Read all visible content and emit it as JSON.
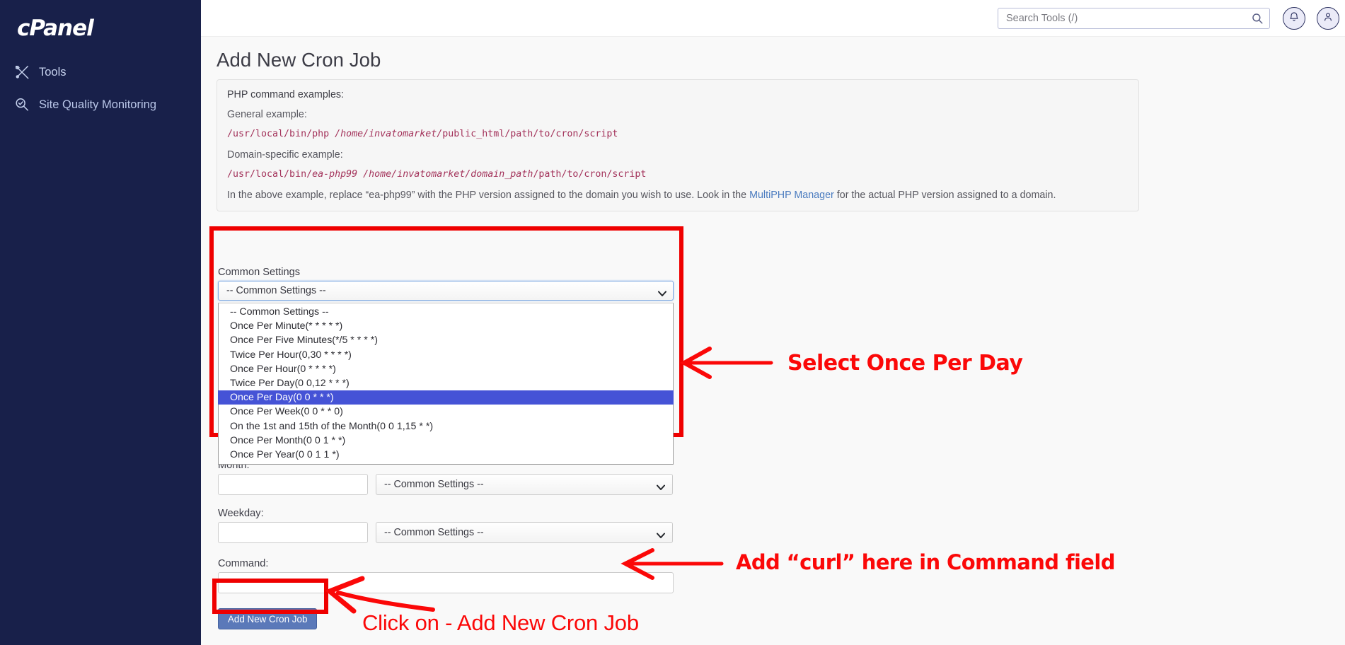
{
  "sidebar": {
    "brand": "cPanel",
    "items": [
      {
        "label": "Tools",
        "icon": "tools-icon"
      },
      {
        "label": "Site Quality Monitoring",
        "icon": "site-quality-icon"
      }
    ]
  },
  "header": {
    "search_placeholder": "Search Tools (/)",
    "search_value": "",
    "search_icon": "search-icon",
    "notifications_icon": "bell-icon",
    "account_icon": "user-icon"
  },
  "main": {
    "title": "Add New Cron Job",
    "php_panel": {
      "heading": "PHP command examples:",
      "general_label": "General example:",
      "general_code_plain": "/usr/local/bin/php ",
      "general_code_italic": "/home/invatomarket/",
      "general_code_tail": "public_html/path/to/cron/script",
      "domain_label": "Domain-specific example:",
      "domain_code_prefix": "/usr/local/bin/",
      "domain_code_italic1": "ea-php99",
      "domain_code_mid": " ",
      "domain_code_italic2": "/home/invatomarket/domain_path",
      "domain_code_tail": "/path/to/cron/script",
      "note_before": "In the above example, replace “ea-php99” with the PHP version assigned to the domain you wish to use. Look in the ",
      "note_link": "MultiPHP Manager",
      "note_after": " for the actual PHP version assigned to a domain."
    },
    "common_settings": {
      "label": "Common Settings",
      "selected": "-- Common Settings --",
      "options": [
        "-- Common Settings --",
        "Once Per Minute(* * * * *)",
        "Once Per Five Minutes(*/5 * * * *)",
        "Twice Per Hour(0,30 * * * *)",
        "Once Per Hour(0 * * * *)",
        "Twice Per Day(0 0,12 * * *)",
        "Once Per Day(0 0 * * *)",
        "Once Per Week(0 0 * * 0)",
        "On the 1st and 15th of the Month(0 0 1,15 * *)",
        "Once Per Month(0 0 1 * *)",
        "Once Per Year(0 0 1 1 *)"
      ],
      "highlighted_index": 6
    },
    "fields": {
      "month_label": "Month:",
      "month_value": "",
      "month_select": "-- Common Settings --",
      "weekday_label": "Weekday:",
      "weekday_value": "",
      "weekday_select": "-- Common Settings --",
      "command_label": "Command:",
      "command_value": ""
    },
    "submit_label": "Add New Cron Job"
  },
  "annotations": {
    "select_day": "Select Once Per Day",
    "curl_prefix": "Add “",
    "curl_word": "curl",
    "curl_suffix": "” here in Command field",
    "click_button": "Click on - Add New Cron Job",
    "color": "#fb0808"
  }
}
